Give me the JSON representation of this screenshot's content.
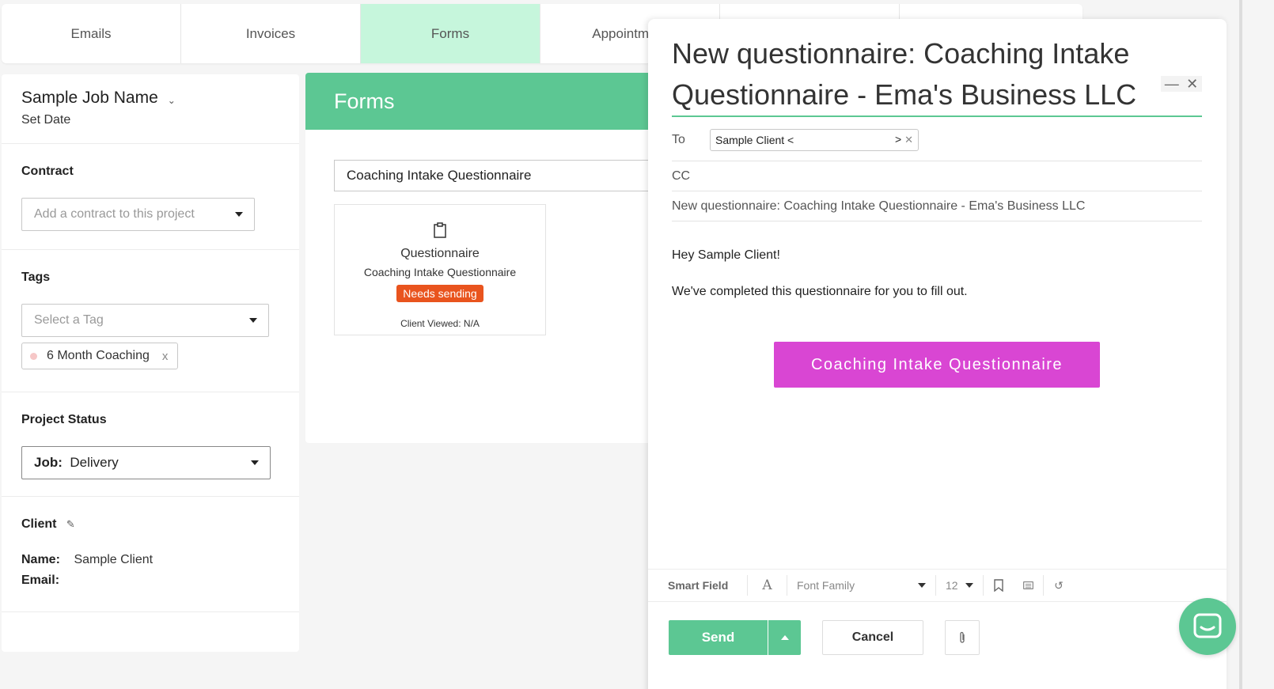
{
  "tabs": [
    {
      "label": "Emails"
    },
    {
      "label": "Invoices"
    },
    {
      "label": "Forms",
      "active": true
    },
    {
      "label": "Appointment"
    }
  ],
  "colors": {
    "accent": "#5cc793",
    "active_tab": "#c6f6dc",
    "badge": "#e9541e",
    "cta": "#d946d3"
  },
  "sidebar": {
    "job_name": "Sample Job Name",
    "set_date": "Set Date",
    "contract": {
      "label": "Contract",
      "placeholder": "Add a contract to this project"
    },
    "tags": {
      "label": "Tags",
      "placeholder": "Select a Tag",
      "chips": [
        {
          "label": "6 Month Coaching",
          "remove": "x"
        }
      ]
    },
    "project_status": {
      "label": "Project Status",
      "key": "Job:",
      "value": "Delivery"
    },
    "client": {
      "label": "Client",
      "name_key": "Name:",
      "name_value": "Sample Client",
      "email_key": "Email:"
    }
  },
  "forms": {
    "header": "Forms",
    "selected_form": "Coaching Intake Questionnaire",
    "card": {
      "icon": "clipboard-icon",
      "title": "Questionnaire",
      "subtitle": "Coaching Intake Questionnaire",
      "badge": "Needs sending",
      "viewed": "Client Viewed: N/A"
    }
  },
  "email": {
    "title": "New questionnaire: Coaching Intake Questionnaire - Ema's Business LLC",
    "to_label": "To",
    "to_chip": "Sample Client <",
    "to_chip_end": ">",
    "cc_label": "CC",
    "subject": "New questionnaire: Coaching Intake Questionnaire - Ema's Business LLC",
    "greeting": "Hey Sample Client!",
    "body": "We've completed this questionnaire for you to fill out.",
    "cta_label": "Coaching Intake Questionnaire",
    "toolbar": {
      "smart_field": "Smart Field",
      "font_family": "Font Family",
      "font_size": "12"
    },
    "send_label": "Send",
    "cancel_label": "Cancel"
  }
}
